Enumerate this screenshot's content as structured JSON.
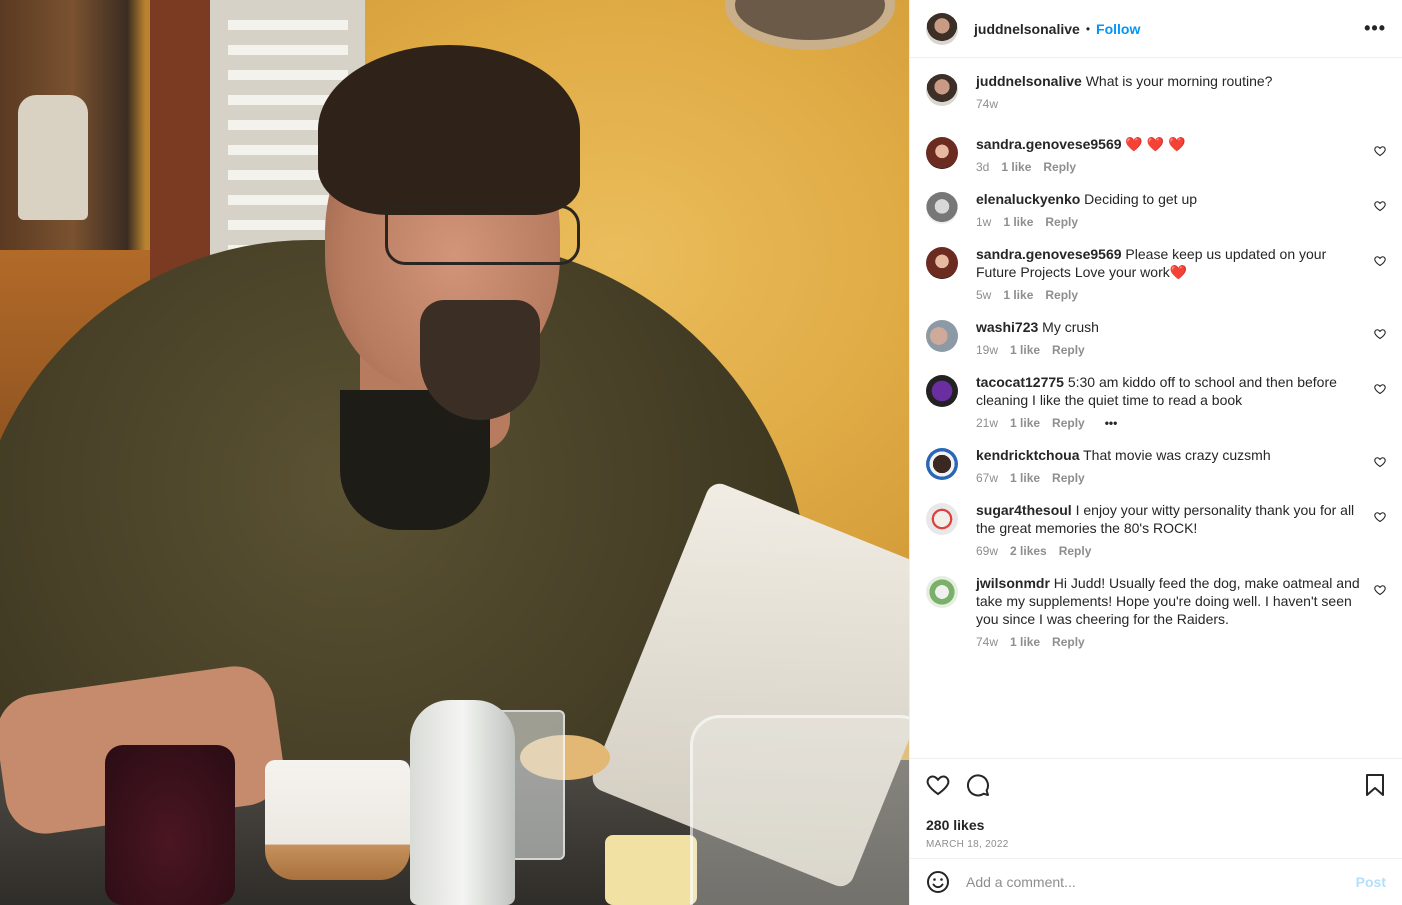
{
  "header": {
    "username": "juddnelsonalive",
    "separator": "•",
    "follow_label": "Follow",
    "more_label": "•••"
  },
  "caption": {
    "username": "juddnelsonalive",
    "text": "What is your morning routine?",
    "time": "74w"
  },
  "comments": [
    {
      "username": "sandra.genovese9569",
      "text": "",
      "emoji": "❤️ ❤️ ❤️",
      "time": "3d",
      "likes": "1 like",
      "reply": "Reply"
    },
    {
      "username": "elenaluckyenko",
      "text": "Deciding to get up",
      "time": "1w",
      "likes": "1 like",
      "reply": "Reply"
    },
    {
      "username": "sandra.genovese9569",
      "text": "Please keep us updated on your Future Projects Love your work",
      "emoji": "❤️",
      "time": "5w",
      "likes": "1 like",
      "reply": "Reply"
    },
    {
      "username": "washi723",
      "text": "My crush",
      "time": "19w",
      "likes": "1 like",
      "reply": "Reply"
    },
    {
      "username": "tacocat12775",
      "text": "5:30 am kiddo off to school and then before cleaning I like the quiet time to read a book",
      "time": "21w",
      "likes": "1 like",
      "reply": "Reply",
      "more": "•••"
    },
    {
      "username": "kendricktchoua",
      "text": "That movie was crazy cuzsmh",
      "time": "67w",
      "likes": "1 like",
      "reply": "Reply"
    },
    {
      "username": "sugar4thesoul",
      "text": "I enjoy your witty personality thank you for all the great memories the 80's ROCK!",
      "time": "69w",
      "likes": "2 likes",
      "reply": "Reply"
    },
    {
      "username": "jwilsonmdr",
      "text": "Hi Judd! Usually feed the dog, make oatmeal and take my supplements! Hope you're doing well. I haven't seen you since I was cheering for the Raiders.",
      "time": "74w",
      "likes": "1 like",
      "reply": "Reply"
    }
  ],
  "post": {
    "likes": "280 likes",
    "date": "MARCH 18, 2022"
  },
  "add_comment": {
    "placeholder": "Add a comment...",
    "post_label": "Post"
  },
  "icons": {
    "like": "heart-icon",
    "comment": "comment-icon",
    "save": "bookmark-icon",
    "emoji": "emoji-icon",
    "comment_like": "small-heart-icon"
  },
  "colors": {
    "accent": "#0095f6",
    "post_disabled": "#b2dffc",
    "heart_emoji": "#ed2c4b",
    "muted": "#8e8e8e"
  }
}
